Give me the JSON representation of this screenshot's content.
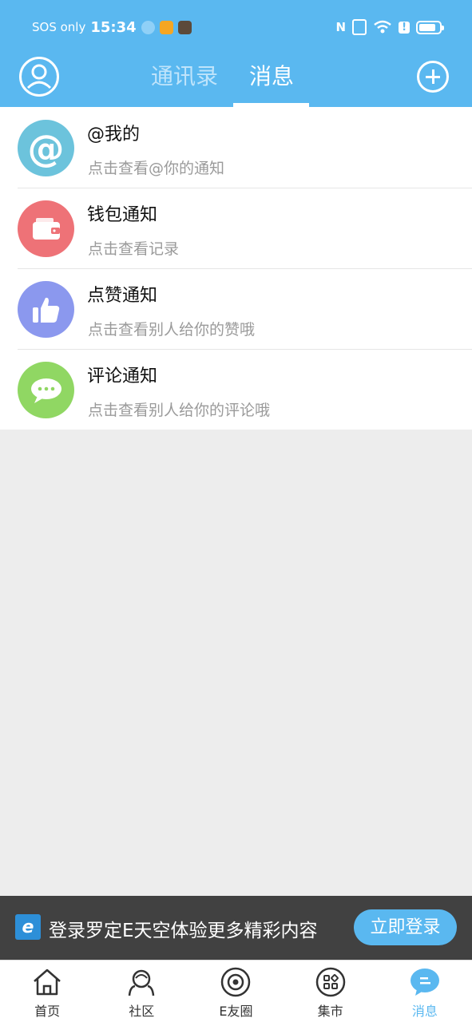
{
  "status_bar": {
    "carrier": "SOS only",
    "time": "15:34",
    "battery_level": 0.85,
    "icons": [
      "weather-icon",
      "app-icon",
      "app-icon",
      "nfc-icon",
      "vibrate-icon",
      "wifi-icon",
      "alert-icon",
      "battery-icon"
    ]
  },
  "header": {
    "tabs": [
      {
        "label": "通讯录",
        "active": false
      },
      {
        "label": "消息",
        "active": true
      }
    ],
    "avatar_icon": "user-avatar-icon",
    "add_icon": "plus-circle-icon"
  },
  "messages": [
    {
      "title": "@我的",
      "subtitle": "点击查看@你的通知",
      "icon": "at-icon",
      "color": "#6cc3dc"
    },
    {
      "title": "钱包通知",
      "subtitle": "点击查看记录",
      "icon": "wallet-icon",
      "color": "#ee7277"
    },
    {
      "title": "点赞通知",
      "subtitle": "点击查看别人给你的赞哦",
      "icon": "thumbs-up-icon",
      "color": "#8b98ee"
    },
    {
      "title": "评论通知",
      "subtitle": "点击查看别人给你的评论哦",
      "icon": "comment-icon",
      "color": "#90d763"
    }
  ],
  "login_banner": {
    "logo": "e",
    "text": "登录罗定E天空体验更多精彩内容",
    "button": "立即登录"
  },
  "bottom_nav": [
    {
      "label": "首页",
      "icon": "home-icon",
      "active": false
    },
    {
      "label": "社区",
      "icon": "community-icon",
      "active": false
    },
    {
      "label": "E友圈",
      "icon": "circle-icon",
      "active": false
    },
    {
      "label": "集市",
      "icon": "market-icon",
      "active": false
    },
    {
      "label": "消息",
      "icon": "message-icon",
      "active": true
    }
  ],
  "colors": {
    "primary": "#5ab8f0",
    "banner_bg": "#414141",
    "page_bg": "#ededed"
  }
}
